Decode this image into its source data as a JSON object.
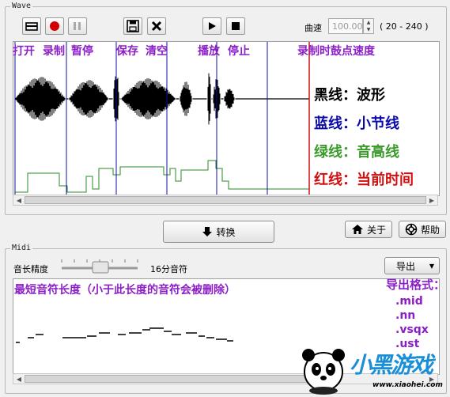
{
  "wave": {
    "group_title": "Wave",
    "toolbar": {
      "open_icon": "folder-open-icon",
      "record_icon": "record-dot-icon",
      "pause_icon": "pause-icon",
      "save_icon": "floppy-disk-icon",
      "clear_icon": "x-clear-icon",
      "play_icon": "play-triangle-icon",
      "stop_icon": "stop-square-icon"
    },
    "speed_label": "曲速",
    "speed_value": "100.00",
    "speed_range": "( 20 - 240 )",
    "annotations": {
      "open": "打开",
      "record": "录制",
      "pause": "暂停",
      "save": "保存",
      "clear": "清空",
      "play": "播放",
      "stop": "停止",
      "record_tempo": "录制时鼓点速度"
    },
    "legend": {
      "black": "黑线：波形",
      "blue": "蓝线：小节线",
      "green": "绿线：音高线",
      "red": "红线：当前时间"
    }
  },
  "convert_button": "转换",
  "about_button": "关于",
  "help_button": "帮助",
  "midi": {
    "group_title": "Midi",
    "note_length_label": "音长精度",
    "note_length_value": "16分音符",
    "export_button": "导出",
    "min_note_note": "最短音符长度（小于此长度的音符会被删除）",
    "export_formats_title": "导出格式：",
    "formats": [
      ".mid",
      ".nn",
      ".vsqx",
      ".ust"
    ]
  },
  "watermark": {
    "brand_text": "小黑游戏",
    "url": "www.xiaohei.com"
  },
  "colors": {
    "waveform": "#000000",
    "bar_lines": "#1010a0",
    "pitch_line": "#2a8a2a",
    "current_time": "#d01010",
    "annotation": "#8b1fc7"
  }
}
